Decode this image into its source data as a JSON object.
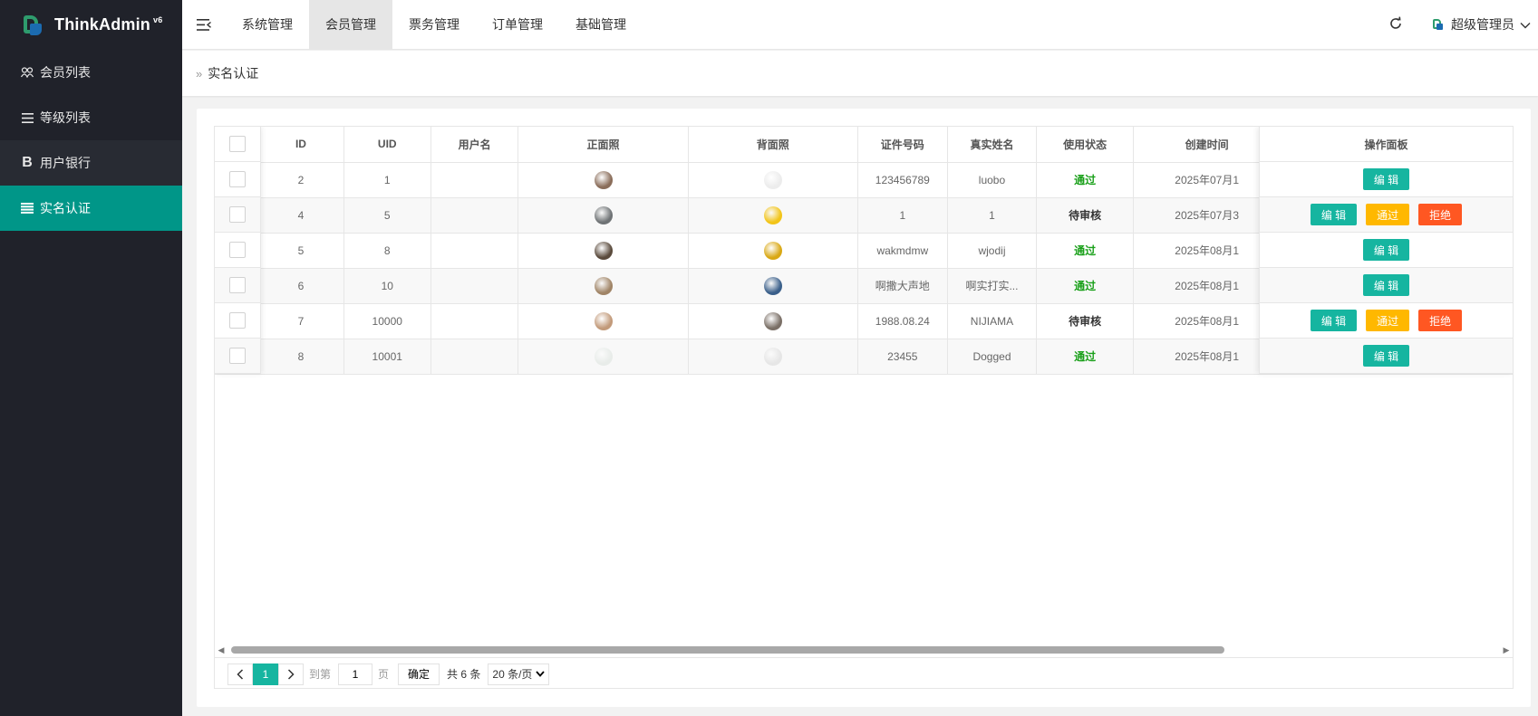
{
  "app": {
    "name": "ThinkAdmin",
    "version": "v6"
  },
  "sidebar": {
    "items": [
      {
        "label": "会员列表",
        "icon": "users-icon"
      },
      {
        "label": "等级列表",
        "icon": "list-icon"
      },
      {
        "label": "用户银行",
        "icon": "bold-b-icon"
      },
      {
        "label": "实名认证",
        "icon": "table-icon",
        "active": true
      }
    ]
  },
  "header": {
    "tabs": [
      {
        "label": "系统管理"
      },
      {
        "label": "会员管理",
        "active": true
      },
      {
        "label": "票务管理"
      },
      {
        "label": "订单管理"
      },
      {
        "label": "基础管理"
      }
    ],
    "user": "超级管理员"
  },
  "breadcrumb": {
    "title": "实名认证"
  },
  "table": {
    "columns": [
      "ID",
      "UID",
      "用户名",
      "正面照",
      "背面照",
      "证件号码",
      "真实姓名",
      "使用状态",
      "创建时间"
    ],
    "ops_header": "操作面板",
    "rows": [
      {
        "id": "2",
        "uid": "1",
        "username": "",
        "front": "#8a6d5a",
        "back": "#ececec",
        "idno": "123456789",
        "name": "luobo",
        "status": "通过",
        "status_type": "pass",
        "created": "2025年07月1",
        "actions": [
          "编 辑"
        ]
      },
      {
        "id": "4",
        "uid": "5",
        "username": "",
        "front": "#6f7375",
        "back": "#f2c418",
        "idno": "1",
        "name": "1",
        "status": "待审核",
        "status_type": "wait",
        "created": "2025年07月3",
        "actions": [
          "编 辑",
          "通过",
          "拒绝"
        ]
      },
      {
        "id": "5",
        "uid": "8",
        "username": "",
        "front": "#5a4a3c",
        "back": "#d9a814",
        "idno": "wakmdmw",
        "name": "wjodij",
        "status": "通过",
        "status_type": "pass",
        "created": "2025年08月1",
        "actions": [
          "编 辑"
        ]
      },
      {
        "id": "6",
        "uid": "10",
        "username": "",
        "front": "#a08466",
        "back": "#3a5f8a",
        "idno": "啊撒大声地",
        "name": "啊实打实...",
        "status": "通过",
        "status_type": "pass",
        "created": "2025年08月1",
        "actions": [
          "编 辑"
        ]
      },
      {
        "id": "7",
        "uid": "10000",
        "username": "",
        "front": "#c29a7a",
        "back": "#7a6f66",
        "idno": "1988.08.24",
        "name": "NIJIAMA",
        "status": "待审核",
        "status_type": "wait",
        "created": "2025年08月1",
        "actions": [
          "编 辑",
          "通过",
          "拒绝"
        ]
      },
      {
        "id": "8",
        "uid": "10001",
        "username": "",
        "front": "#e8ece9",
        "back": "#e6e6e6",
        "idno": "23455",
        "name": "Dogged",
        "status": "通过",
        "status_type": "pass",
        "created": "2025年08月1",
        "actions": [
          "编 辑"
        ]
      }
    ]
  },
  "pager": {
    "prev": "‹",
    "current": "1",
    "next": "›",
    "goto_label": "到第",
    "page_input": "1",
    "page_unit": "页",
    "confirm": "确定",
    "total": "共 6 条",
    "per_page": "20 条/页"
  },
  "colors": {
    "accent": "#009688",
    "sidebar": "#20222a",
    "edit": "#16b5a0",
    "pass": "#ffb800",
    "reject": "#ff5722"
  }
}
